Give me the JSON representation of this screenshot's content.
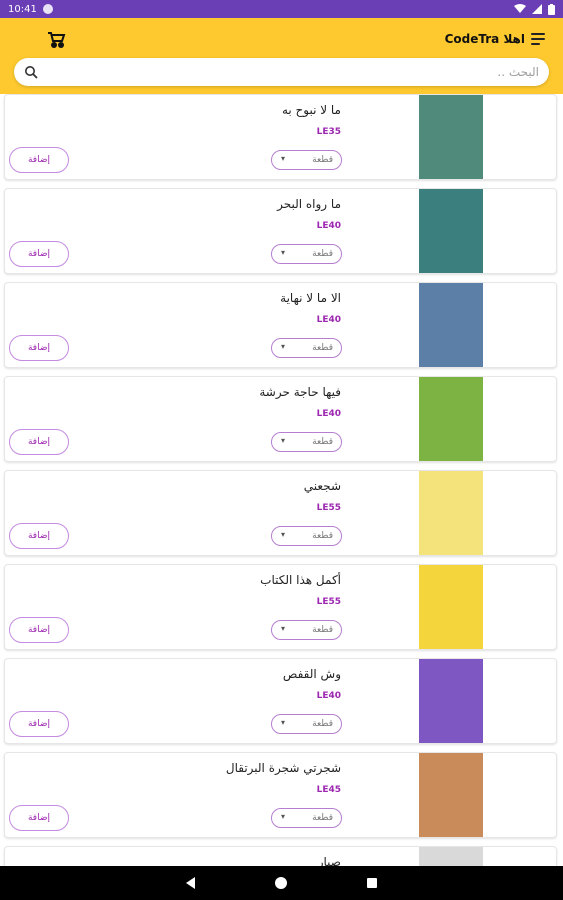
{
  "status_bar": {
    "time": "10:41"
  },
  "header": {
    "greeting": "اهلا CodeTra"
  },
  "search": {
    "placeholder": "البحث .."
  },
  "products": [
    {
      "title": "ما لا نبوح به",
      "price": "LE35",
      "dropdown_label": "قطعة",
      "add_label": "إضافة",
      "cover_color": "#4f8a7a"
    },
    {
      "title": "ما رواه البحر",
      "price": "LE40",
      "dropdown_label": "قطعة",
      "add_label": "إضافة",
      "cover_color": "#3b7f7e"
    },
    {
      "title": "الا ما لا نهاية",
      "price": "LE40",
      "dropdown_label": "قطعة",
      "add_label": "إضافة",
      "cover_color": "#5c7fa8"
    },
    {
      "title": "فيها حاجة حرشة",
      "price": "LE40",
      "dropdown_label": "قطعة",
      "add_label": "إضافة",
      "cover_color": "#7cb342"
    },
    {
      "title": "شجعني",
      "price": "LE55",
      "dropdown_label": "قطعة",
      "add_label": "إضافة",
      "cover_color": "#f3e37a"
    },
    {
      "title": "أكمل هذا الكتاب",
      "price": "LE55",
      "dropdown_label": "قطعة",
      "add_label": "إضافة",
      "cover_color": "#f4d53c"
    },
    {
      "title": "وش القفص",
      "price": "LE40",
      "dropdown_label": "قطعة",
      "add_label": "إضافة",
      "cover_color": "#7e57c2"
    },
    {
      "title": "شجرتي شجرة البرتقال",
      "price": "LE45",
      "dropdown_label": "قطعة",
      "add_label": "إضافة",
      "cover_color": "#c98b5a"
    },
    {
      "title": "صبار",
      "price": "",
      "dropdown_label": "",
      "add_label": "",
      "cover_color": "#d9d9d9"
    }
  ],
  "colors": {
    "status_bar": "#6a3fb6",
    "app_bar": "#fdc92e",
    "accent": "#9c27b0"
  }
}
